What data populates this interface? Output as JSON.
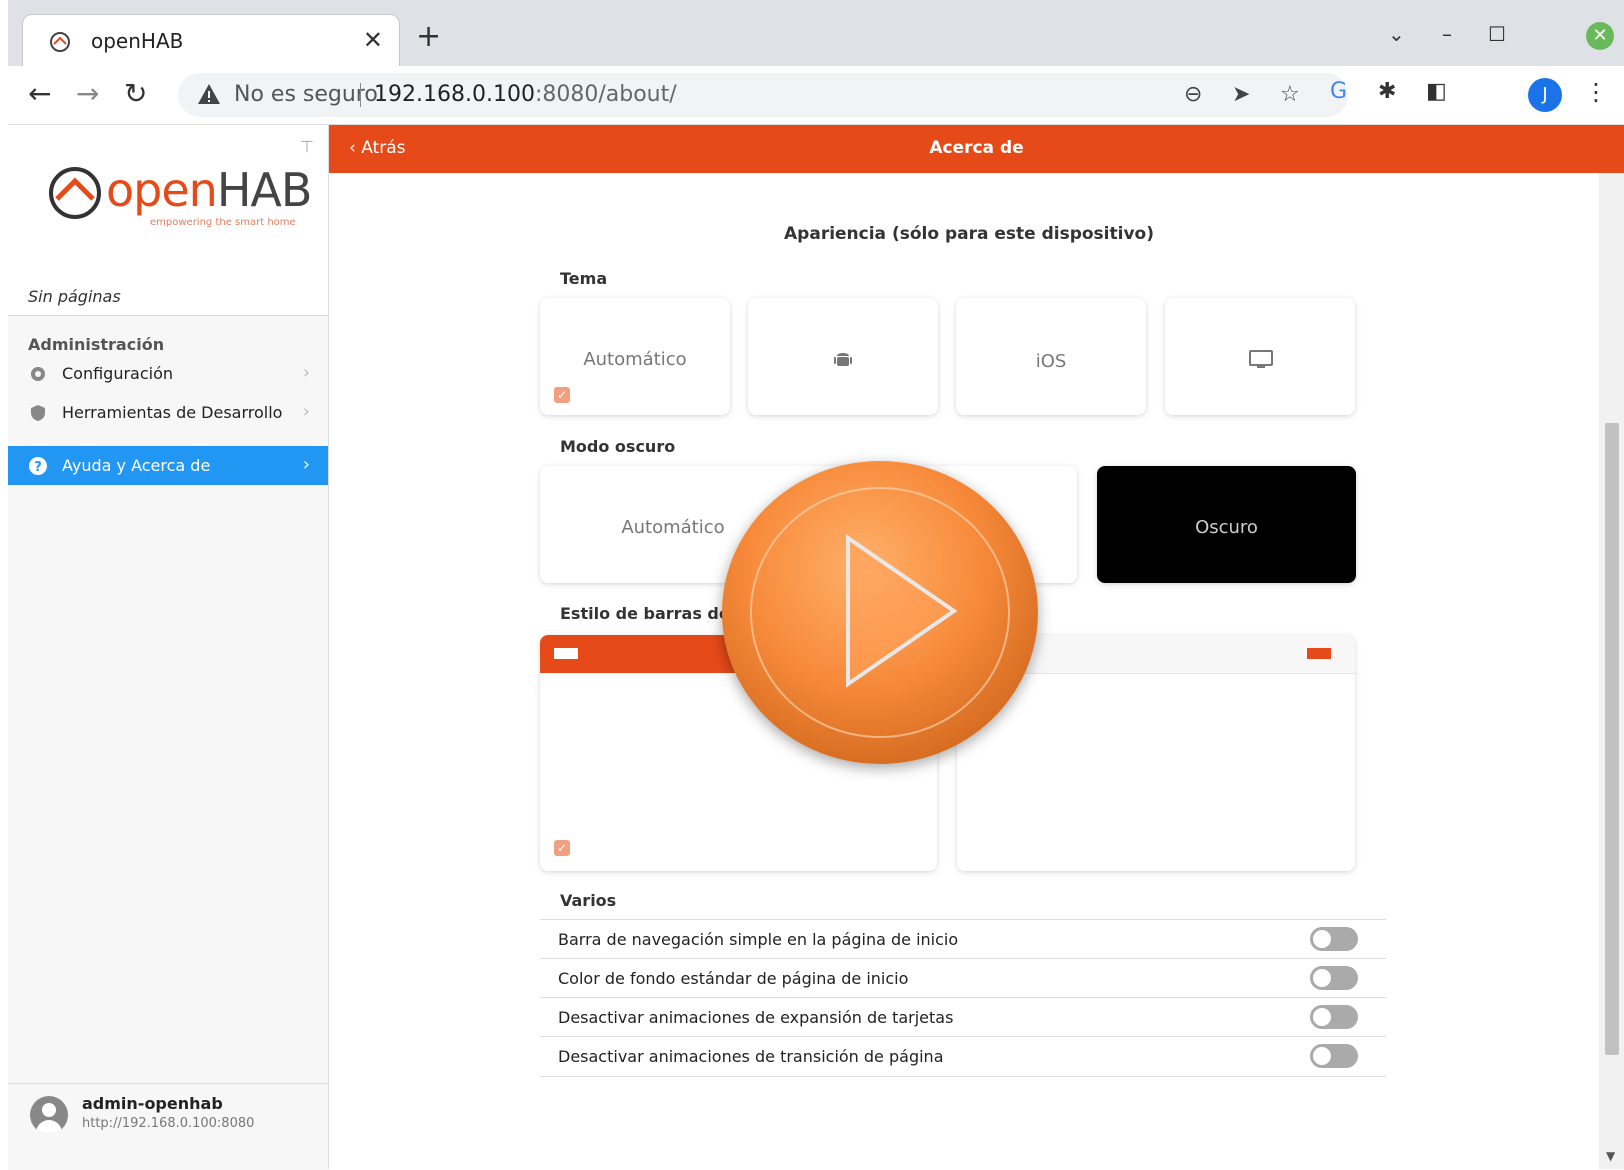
{
  "browser": {
    "tab_title": "openHAB",
    "tab_close": "✕",
    "new_tab": "+",
    "insecure_label": "No es seguro",
    "url_host": "192.168.0.100",
    "url_rest": ":8080/about/",
    "profile_initial": "J"
  },
  "sidebar": {
    "logo_open": "open",
    "logo_hab": "HAB",
    "logo_tagline": "empowering the smart home",
    "no_pages": "Sin páginas",
    "admin_section": "Administración",
    "items": [
      {
        "label": "Configuración",
        "icon": "gear-icon"
      },
      {
        "label": "Herramientas de Desarrollo",
        "icon": "shield-icon"
      },
      {
        "label": "Ayuda y Acerca de",
        "icon": "help-icon"
      }
    ],
    "user_name": "admin-openhab",
    "user_url": "http://192.168.0.100:8080"
  },
  "navbar": {
    "back_label": "Atrás",
    "title": "Acerca de"
  },
  "main": {
    "heading": "Apariencia (sólo para este dispositivo)",
    "theme": {
      "title": "Tema",
      "options": [
        "Automático",
        "android-icon",
        "iOS",
        "desktop-icon"
      ],
      "selected": "Automático"
    },
    "dark_mode": {
      "title": "Modo oscuro",
      "options": [
        "Automático",
        "Oscuro"
      ],
      "selected": "Automático"
    },
    "nav_bar_style": {
      "title": "Estilo de barras de n"
    },
    "misc": {
      "title": "Varios",
      "items": [
        "Barra de navegación simple en la página de inicio",
        "Color de fondo estándar de página de inicio",
        "Desactivar animaciones de expansión de tarjetas",
        "Desactivar animaciones de transición de página"
      ]
    }
  },
  "colors": {
    "accent": "#e64a19",
    "active_sidebar": "#2196f3",
    "play_button": "#f78a3a"
  }
}
